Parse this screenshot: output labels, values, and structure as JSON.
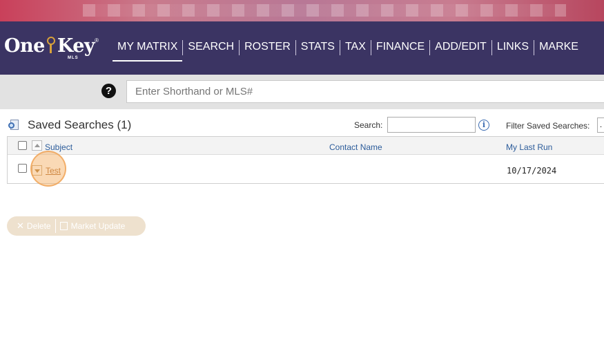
{
  "brand": {
    "logo_left": "One",
    "logo_right": "Key",
    "logo_sub": "MLS",
    "registered": "®"
  },
  "nav": {
    "items": [
      "MY MATRIX",
      "SEARCH",
      "ROSTER",
      "STATS",
      "TAX",
      "FINANCE",
      "ADD/EDIT",
      "LINKS",
      "MARKE"
    ],
    "active": "MY MATRIX"
  },
  "shorthand": {
    "placeholder": "Enter Shorthand or MLS#"
  },
  "panel": {
    "title": "Saved Searches (1)",
    "search_label": "Search:",
    "filter_label": "Filter Saved Searches:"
  },
  "table": {
    "headers": {
      "subject": "Subject",
      "contact": "Contact Name",
      "last_run": "My Last Run"
    },
    "rows": [
      {
        "subject": "Test",
        "contact": "",
        "last_run": "10/17/2024"
      }
    ]
  },
  "actions": {
    "delete_label": "Delete",
    "market_update_label": "Market Update"
  },
  "colors": {
    "nav_bg": "#3b3463",
    "link": "#b0692a",
    "header_link": "#2c5c9a"
  }
}
